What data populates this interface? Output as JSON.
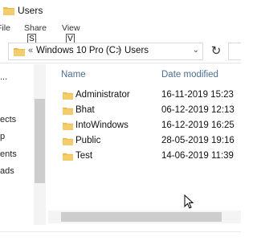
{
  "window": {
    "title": "Users"
  },
  "ribbon": {
    "tabs": [
      "File",
      "Share",
      "View"
    ],
    "keytips": [
      "S",
      "V"
    ]
  },
  "address": {
    "crumbs": [
      "Windows 10 Pro (C:)",
      "Users"
    ],
    "separator": ">",
    "back_separator": "«",
    "dropdown": "⌄",
    "refresh": "↻"
  },
  "nav": {
    "items": [
      "...",
      "ects",
      "p",
      "ents",
      "ads"
    ]
  },
  "columns": {
    "name": "Name",
    "date": "Date modified"
  },
  "files": [
    {
      "name": "Administrator",
      "date": "16-11-2019 15:23"
    },
    {
      "name": "Bhat",
      "date": "06-12-2019 12:13"
    },
    {
      "name": "IntoWindows",
      "date": "16-12-2019 16:25"
    },
    {
      "name": "Public",
      "date": "28-05-2019 19:16"
    },
    {
      "name": "Test",
      "date": "14-06-2019 11:39"
    }
  ],
  "colors": {
    "folder": "#e8b94a",
    "header": "#4d6d8f"
  }
}
